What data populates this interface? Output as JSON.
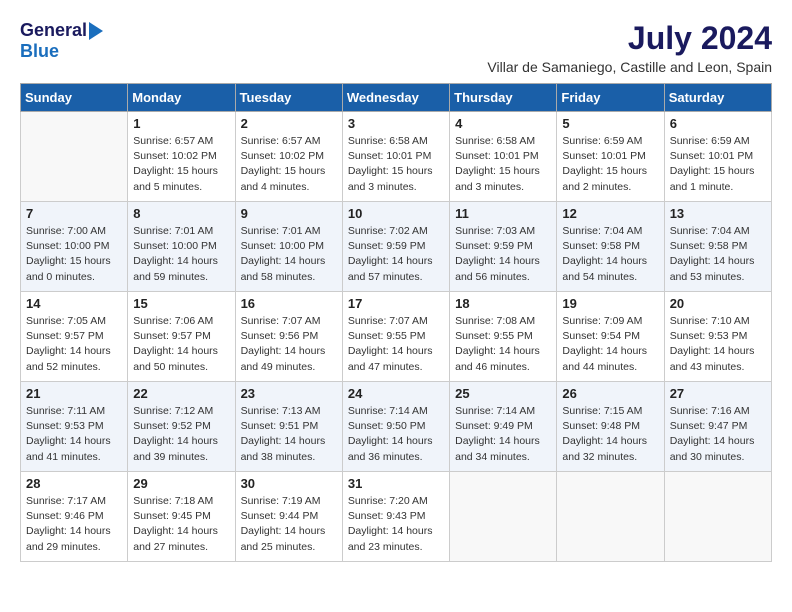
{
  "header": {
    "logo_general": "General",
    "logo_blue": "Blue",
    "month_year": "July 2024",
    "location": "Villar de Samaniego, Castille and Leon, Spain"
  },
  "columns": [
    "Sunday",
    "Monday",
    "Tuesday",
    "Wednesday",
    "Thursday",
    "Friday",
    "Saturday"
  ],
  "weeks": [
    [
      {
        "day": "",
        "detail": ""
      },
      {
        "day": "1",
        "detail": "Sunrise: 6:57 AM\nSunset: 10:02 PM\nDaylight: 15 hours\nand 5 minutes."
      },
      {
        "day": "2",
        "detail": "Sunrise: 6:57 AM\nSunset: 10:02 PM\nDaylight: 15 hours\nand 4 minutes."
      },
      {
        "day": "3",
        "detail": "Sunrise: 6:58 AM\nSunset: 10:01 PM\nDaylight: 15 hours\nand 3 minutes."
      },
      {
        "day": "4",
        "detail": "Sunrise: 6:58 AM\nSunset: 10:01 PM\nDaylight: 15 hours\nand 3 minutes."
      },
      {
        "day": "5",
        "detail": "Sunrise: 6:59 AM\nSunset: 10:01 PM\nDaylight: 15 hours\nand 2 minutes."
      },
      {
        "day": "6",
        "detail": "Sunrise: 6:59 AM\nSunset: 10:01 PM\nDaylight: 15 hours\nand 1 minute."
      }
    ],
    [
      {
        "day": "7",
        "detail": "Sunrise: 7:00 AM\nSunset: 10:00 PM\nDaylight: 15 hours\nand 0 minutes."
      },
      {
        "day": "8",
        "detail": "Sunrise: 7:01 AM\nSunset: 10:00 PM\nDaylight: 14 hours\nand 59 minutes."
      },
      {
        "day": "9",
        "detail": "Sunrise: 7:01 AM\nSunset: 10:00 PM\nDaylight: 14 hours\nand 58 minutes."
      },
      {
        "day": "10",
        "detail": "Sunrise: 7:02 AM\nSunset: 9:59 PM\nDaylight: 14 hours\nand 57 minutes."
      },
      {
        "day": "11",
        "detail": "Sunrise: 7:03 AM\nSunset: 9:59 PM\nDaylight: 14 hours\nand 56 minutes."
      },
      {
        "day": "12",
        "detail": "Sunrise: 7:04 AM\nSunset: 9:58 PM\nDaylight: 14 hours\nand 54 minutes."
      },
      {
        "day": "13",
        "detail": "Sunrise: 7:04 AM\nSunset: 9:58 PM\nDaylight: 14 hours\nand 53 minutes."
      }
    ],
    [
      {
        "day": "14",
        "detail": "Sunrise: 7:05 AM\nSunset: 9:57 PM\nDaylight: 14 hours\nand 52 minutes."
      },
      {
        "day": "15",
        "detail": "Sunrise: 7:06 AM\nSunset: 9:57 PM\nDaylight: 14 hours\nand 50 minutes."
      },
      {
        "day": "16",
        "detail": "Sunrise: 7:07 AM\nSunset: 9:56 PM\nDaylight: 14 hours\nand 49 minutes."
      },
      {
        "day": "17",
        "detail": "Sunrise: 7:07 AM\nSunset: 9:55 PM\nDaylight: 14 hours\nand 47 minutes."
      },
      {
        "day": "18",
        "detail": "Sunrise: 7:08 AM\nSunset: 9:55 PM\nDaylight: 14 hours\nand 46 minutes."
      },
      {
        "day": "19",
        "detail": "Sunrise: 7:09 AM\nSunset: 9:54 PM\nDaylight: 14 hours\nand 44 minutes."
      },
      {
        "day": "20",
        "detail": "Sunrise: 7:10 AM\nSunset: 9:53 PM\nDaylight: 14 hours\nand 43 minutes."
      }
    ],
    [
      {
        "day": "21",
        "detail": "Sunrise: 7:11 AM\nSunset: 9:53 PM\nDaylight: 14 hours\nand 41 minutes."
      },
      {
        "day": "22",
        "detail": "Sunrise: 7:12 AM\nSunset: 9:52 PM\nDaylight: 14 hours\nand 39 minutes."
      },
      {
        "day": "23",
        "detail": "Sunrise: 7:13 AM\nSunset: 9:51 PM\nDaylight: 14 hours\nand 38 minutes."
      },
      {
        "day": "24",
        "detail": "Sunrise: 7:14 AM\nSunset: 9:50 PM\nDaylight: 14 hours\nand 36 minutes."
      },
      {
        "day": "25",
        "detail": "Sunrise: 7:14 AM\nSunset: 9:49 PM\nDaylight: 14 hours\nand 34 minutes."
      },
      {
        "day": "26",
        "detail": "Sunrise: 7:15 AM\nSunset: 9:48 PM\nDaylight: 14 hours\nand 32 minutes."
      },
      {
        "day": "27",
        "detail": "Sunrise: 7:16 AM\nSunset: 9:47 PM\nDaylight: 14 hours\nand 30 minutes."
      }
    ],
    [
      {
        "day": "28",
        "detail": "Sunrise: 7:17 AM\nSunset: 9:46 PM\nDaylight: 14 hours\nand 29 minutes."
      },
      {
        "day": "29",
        "detail": "Sunrise: 7:18 AM\nSunset: 9:45 PM\nDaylight: 14 hours\nand 27 minutes."
      },
      {
        "day": "30",
        "detail": "Sunrise: 7:19 AM\nSunset: 9:44 PM\nDaylight: 14 hours\nand 25 minutes."
      },
      {
        "day": "31",
        "detail": "Sunrise: 7:20 AM\nSunset: 9:43 PM\nDaylight: 14 hours\nand 23 minutes."
      },
      {
        "day": "",
        "detail": ""
      },
      {
        "day": "",
        "detail": ""
      },
      {
        "day": "",
        "detail": ""
      }
    ]
  ]
}
